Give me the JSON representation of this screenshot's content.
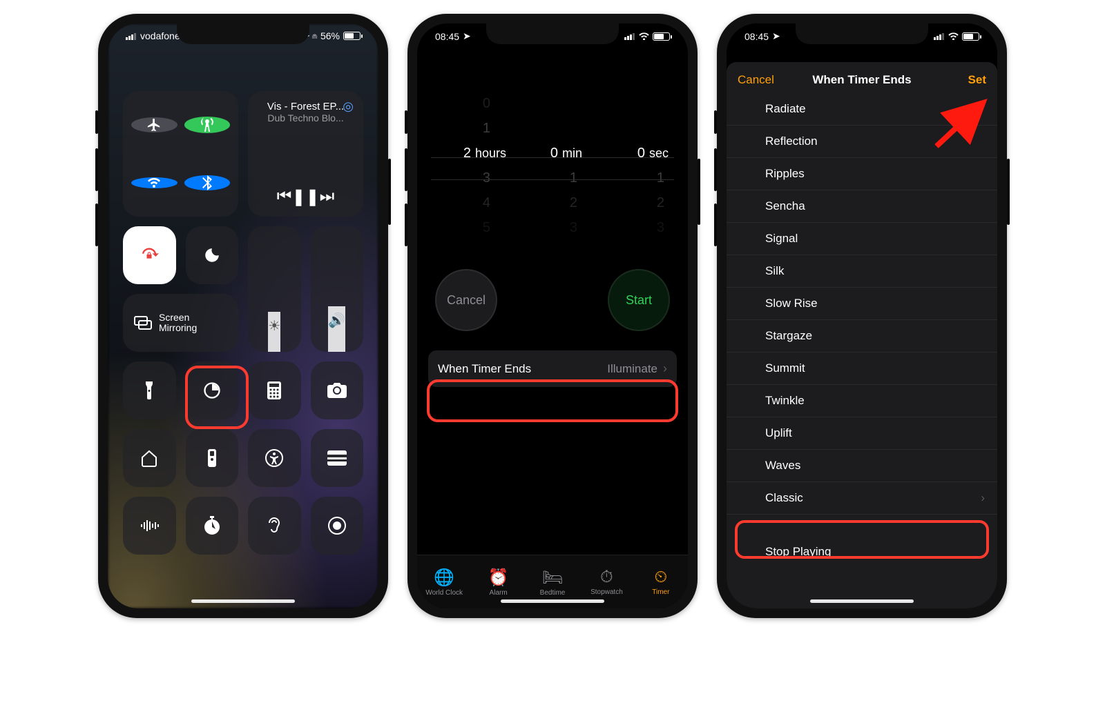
{
  "screen1": {
    "status": {
      "carrier": "vodafone UK",
      "vpn": "VPN",
      "battery_text": "56%",
      "battery_fill_pct": 56
    },
    "media": {
      "title": "Vis - Forest EP...",
      "subtitle": "Dub Techno Blo..."
    },
    "mirror_label": "Screen\nMirroring"
  },
  "screen2": {
    "status_time": "08:45",
    "picker": {
      "hours": {
        "selected": "2",
        "label": "hours",
        "above": [
          "0",
          "1"
        ],
        "below": [
          "3",
          "4",
          "5"
        ]
      },
      "min": {
        "selected": "0",
        "label": "min",
        "above": [
          "",
          ""
        ],
        "below": [
          "1",
          "2",
          "3"
        ]
      },
      "sec": {
        "selected": "0",
        "label": "sec",
        "above": [
          "",
          ""
        ],
        "below": [
          "1",
          "2",
          "3"
        ]
      }
    },
    "cancel": "Cancel",
    "start": "Start",
    "when_label": "When Timer Ends",
    "when_value": "Illuminate",
    "tabs": [
      "World Clock",
      "Alarm",
      "Bedtime",
      "Stopwatch",
      "Timer"
    ]
  },
  "screen3": {
    "status_time": "08:45",
    "hdr_title": "When Timer Ends",
    "hdr_cancel": "Cancel",
    "hdr_set": "Set",
    "sounds": [
      "Radiate",
      "Reflection",
      "Ripples",
      "Sencha",
      "Signal",
      "Silk",
      "Slow Rise",
      "Stargaze",
      "Summit",
      "Twinkle",
      "Uplift",
      "Waves"
    ],
    "classic": "Classic",
    "stop_playing": "Stop Playing"
  }
}
